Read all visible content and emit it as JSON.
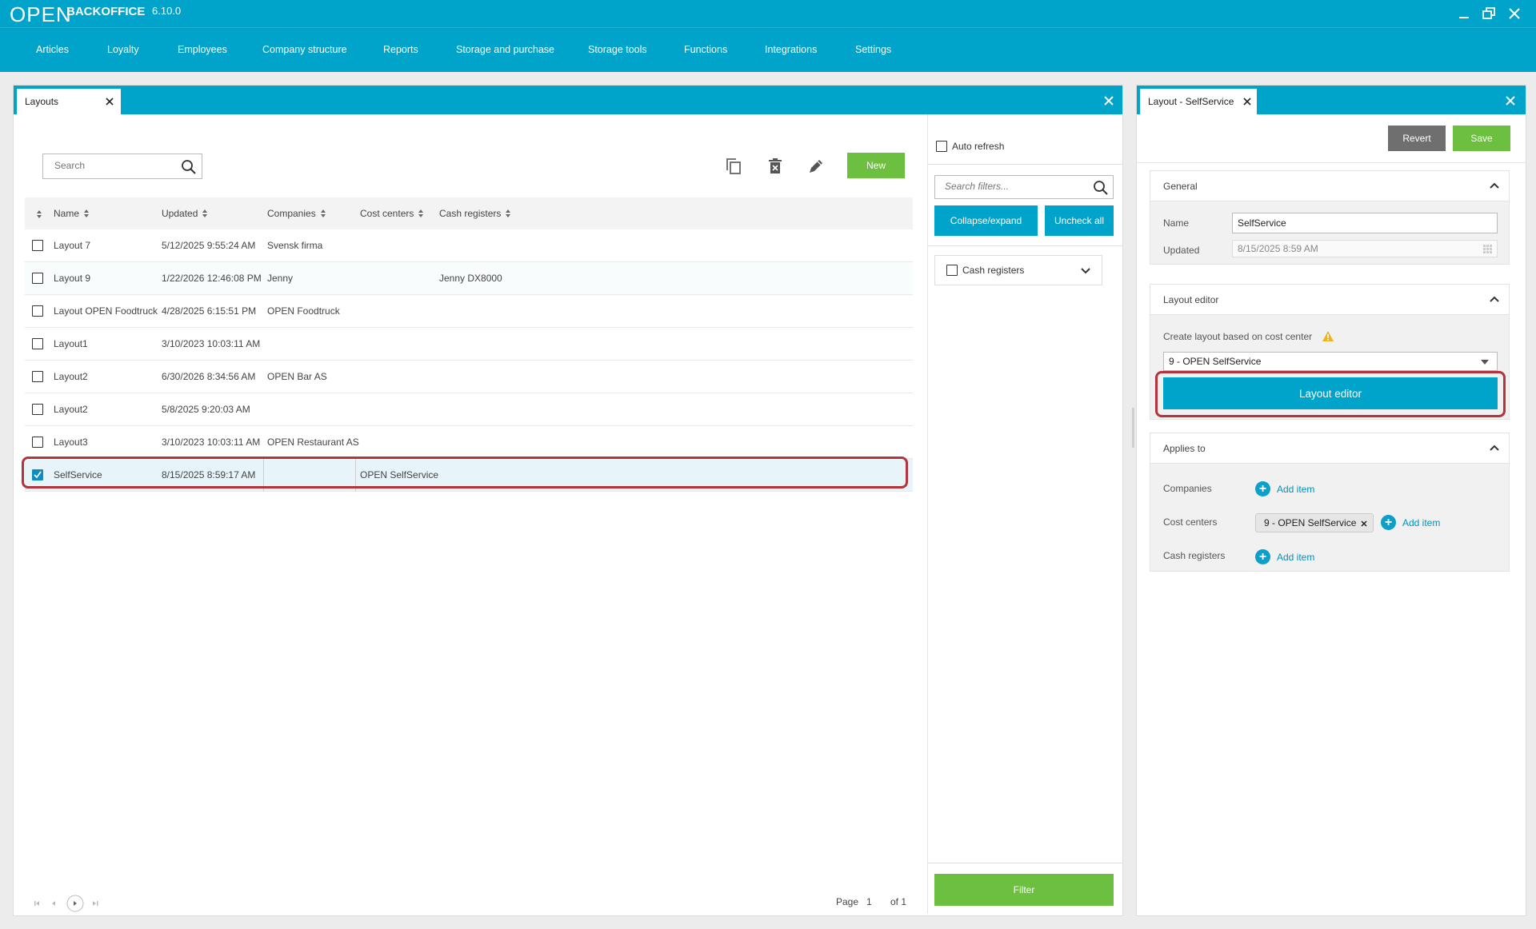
{
  "app": {
    "logo": "OPEN",
    "name": "BACKOFFICE",
    "version": "6.10.0"
  },
  "menu": [
    "Articles",
    "Loyalty",
    "Employees",
    "Company structure",
    "Reports",
    "Storage and purchase",
    "Storage tools",
    "Functions",
    "Integrations",
    "Settings"
  ],
  "layouts_panel": {
    "tab_label": "Layouts",
    "search_placeholder": "Search",
    "new_label": "New",
    "columns": [
      "Name",
      "Updated",
      "Companies",
      "Cost centers",
      "Cash registers"
    ],
    "rows": [
      {
        "name": "Layout 7",
        "updated": "5/12/2025 9:55:24 AM",
        "companies": "Svensk firma",
        "cost_centers": "",
        "cash_registers": "",
        "checked": false
      },
      {
        "name": "Layout 9",
        "updated": "1/22/2026 12:46:08 PM",
        "companies": "Jenny",
        "cost_centers": "",
        "cash_registers": "Jenny DX8000",
        "checked": false
      },
      {
        "name": "Layout OPEN Foodtruck",
        "updated": "4/28/2025 6:15:51 PM",
        "companies": "OPEN Foodtruck",
        "cost_centers": "",
        "cash_registers": "",
        "checked": false
      },
      {
        "name": "Layout1",
        "updated": "3/10/2023 10:03:11 AM",
        "companies": "",
        "cost_centers": "",
        "cash_registers": "",
        "checked": false
      },
      {
        "name": "Layout2",
        "updated": "6/30/2026 8:34:56 AM",
        "companies": "OPEN Bar AS",
        "cost_centers": "",
        "cash_registers": "",
        "checked": false
      },
      {
        "name": "Layout2",
        "updated": "5/8/2025 9:20:03 AM",
        "companies": "",
        "cost_centers": "",
        "cash_registers": "",
        "checked": false
      },
      {
        "name": "Layout3",
        "updated": "3/10/2023 10:03:11 AM",
        "companies": "OPEN Restaurant AS",
        "cost_centers": "",
        "cash_registers": "",
        "checked": false
      },
      {
        "name": "SelfService",
        "updated": "8/15/2025 8:59:17 AM",
        "companies": "",
        "cost_centers": "OPEN SelfService",
        "cash_registers": "",
        "checked": true
      }
    ],
    "pager": {
      "page_label": "Page",
      "page": "1",
      "of_label": "of 1"
    }
  },
  "filters": {
    "auto_refresh_label": "Auto refresh",
    "search_placeholder": "Search filters...",
    "collapse_label": "Collapse/expand",
    "uncheck_label": "Uncheck all",
    "cash_registers_label": "Cash registers",
    "filter_button": "Filter"
  },
  "detail_panel": {
    "tab_label": "Layout - SelfService",
    "revert_label": "Revert",
    "save_label": "Save",
    "general": {
      "title": "General",
      "name_label": "Name",
      "name_value": "SelfService",
      "updated_label": "Updated",
      "updated_value": "8/15/2025 8:59 AM"
    },
    "layout_editor": {
      "title": "Layout editor",
      "create_label": "Create layout based on cost center",
      "selected_cost_center": "9 - OPEN SelfService",
      "button_label": "Layout editor"
    },
    "applies_to": {
      "title": "Applies to",
      "companies_label": "Companies",
      "cost_centers_label": "Cost centers",
      "cash_registers_label": "Cash registers",
      "add_item_label": "Add item",
      "cost_center_chip": "9 - OPEN SelfService"
    }
  },
  "colors": {
    "accent": "#00a3c9",
    "green": "#6cbf3f",
    "highlight": "#b3343a"
  }
}
